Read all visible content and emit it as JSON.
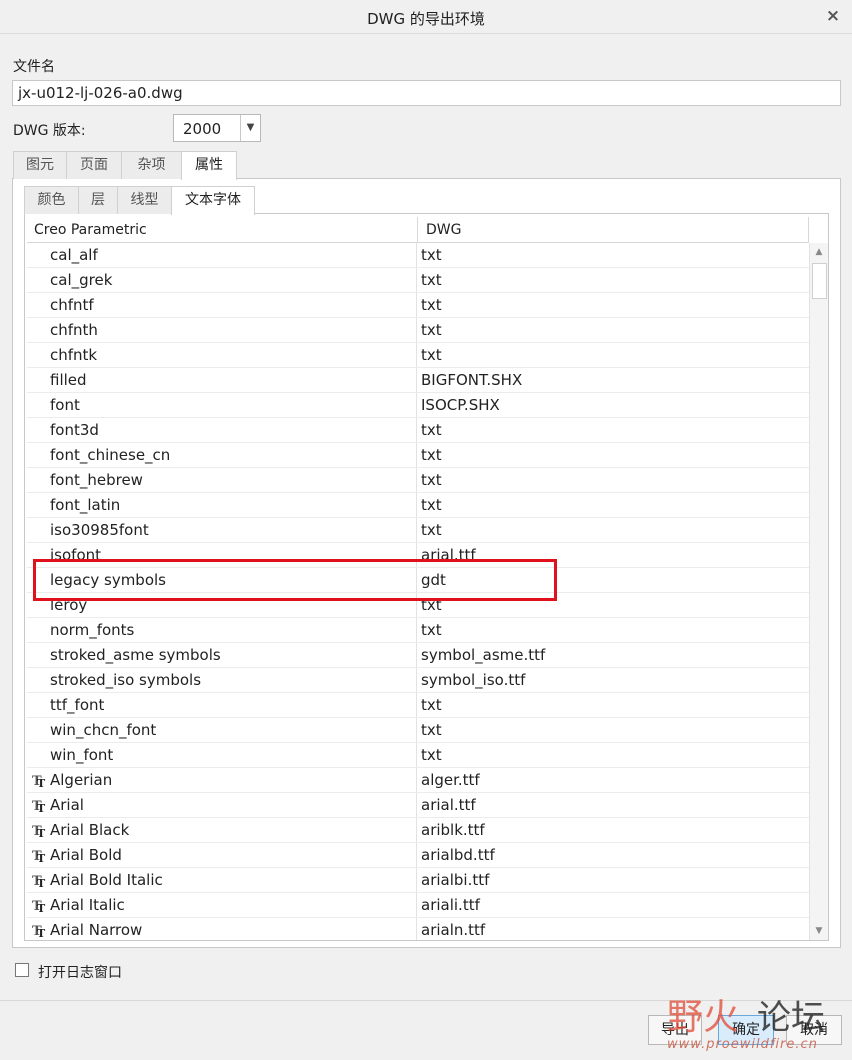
{
  "window": {
    "title": "DWG 的导出环境",
    "close_glyph": "×"
  },
  "filename": {
    "label": "文件名",
    "value": "jx-u012-lj-026-a0.dwg"
  },
  "version": {
    "label": "DWG 版本:",
    "value": "2000",
    "arrow": "▼"
  },
  "outer_tabs": [
    "图元",
    "页面",
    "杂项",
    "属性"
  ],
  "outer_active": "属性",
  "inner_tabs": [
    "颜色",
    "层",
    "线型",
    "文本字体"
  ],
  "inner_active": "文本字体",
  "grid": {
    "columns": [
      "Creo Parametric",
      "DWG"
    ],
    "rows": [
      {
        "name": "cal_alf",
        "value": "txt",
        "truetype": false
      },
      {
        "name": "cal_grek",
        "value": "txt",
        "truetype": false
      },
      {
        "name": "chfntf",
        "value": "txt",
        "truetype": false
      },
      {
        "name": "chfnth",
        "value": "txt",
        "truetype": false
      },
      {
        "name": "chfntk",
        "value": "txt",
        "truetype": false
      },
      {
        "name": "filled",
        "value": "BIGFONT.SHX",
        "truetype": false
      },
      {
        "name": "font",
        "value": "ISOCP.SHX",
        "truetype": false
      },
      {
        "name": "font3d",
        "value": "txt",
        "truetype": false
      },
      {
        "name": "font_chinese_cn",
        "value": "txt",
        "truetype": false
      },
      {
        "name": "font_hebrew",
        "value": "txt",
        "truetype": false
      },
      {
        "name": "font_latin",
        "value": "txt",
        "truetype": false
      },
      {
        "name": "iso30985font",
        "value": "txt",
        "truetype": false
      },
      {
        "name": "isofont",
        "value": "arial.ttf",
        "truetype": false
      },
      {
        "name": "legacy symbols",
        "value": "gdt",
        "truetype": false
      },
      {
        "name": "leroy",
        "value": "txt",
        "truetype": false
      },
      {
        "name": "norm_fonts",
        "value": "txt",
        "truetype": false
      },
      {
        "name": "stroked_asme symbols",
        "value": "symbol_asme.ttf",
        "truetype": false
      },
      {
        "name": "stroked_iso symbols",
        "value": "symbol_iso.ttf",
        "truetype": false
      },
      {
        "name": "ttf_font",
        "value": "txt",
        "truetype": false
      },
      {
        "name": "win_chcn_font",
        "value": "txt",
        "truetype": false
      },
      {
        "name": "win_font",
        "value": "txt",
        "truetype": false
      },
      {
        "name": "Algerian",
        "value": "alger.ttf",
        "truetype": true
      },
      {
        "name": "Arial",
        "value": "arial.ttf",
        "truetype": true
      },
      {
        "name": "Arial Black",
        "value": "ariblk.ttf",
        "truetype": true
      },
      {
        "name": "Arial Bold",
        "value": "arialbd.ttf",
        "truetype": true
      },
      {
        "name": "Arial Bold Italic",
        "value": "arialbi.ttf",
        "truetype": true
      },
      {
        "name": "Arial Italic",
        "value": "ariali.ttf",
        "truetype": true
      },
      {
        "name": "Arial Narrow",
        "value": "arialn.ttf",
        "truetype": true
      }
    ],
    "highlighted_row": "legacy symbols"
  },
  "scrollbar": {
    "up_glyph": "▲",
    "down_glyph": "▼"
  },
  "log_window": {
    "label": "打开日志窗口",
    "checked": false
  },
  "buttons": {
    "export": "导出",
    "ok": "确定",
    "cancel": "取消"
  },
  "watermark": {
    "brand_1": "野火",
    "brand_2": "论坛",
    "url": "www.proewildfire.cn"
  },
  "colors": {
    "highlight_border": "#e0101c",
    "primary_button": "#d9ecfb"
  }
}
